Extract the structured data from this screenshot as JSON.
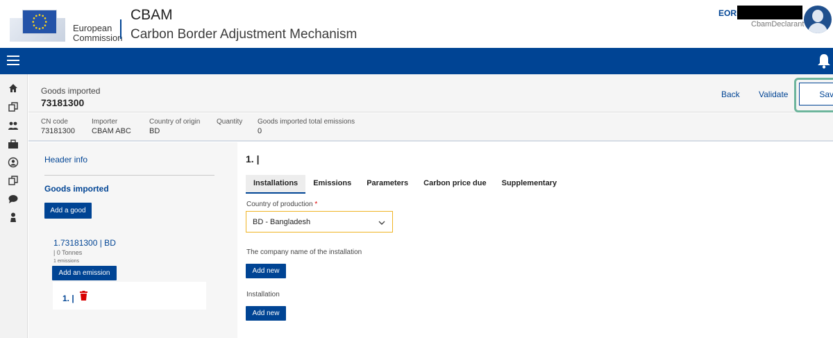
{
  "header": {
    "ec_line1": "European",
    "ec_line2": "Commission",
    "app_title": "CBAM",
    "app_subtitle": "Carbon Border Adjustment Mechanism",
    "eori_label": "EORI",
    "user_role": "CbamDeclarant"
  },
  "page": {
    "label": "Goods imported",
    "code": "73181300",
    "actions": {
      "back": "Back",
      "validate": "Validate",
      "save": "Save"
    }
  },
  "meta": [
    {
      "label": "CN code",
      "value": "73181300"
    },
    {
      "label": "Importer",
      "value": "CBAM ABC"
    },
    {
      "label": "Country of origin",
      "value": "BD"
    },
    {
      "label": "Quantity",
      "value": ""
    },
    {
      "label": "Goods imported total emissions",
      "value": "0"
    }
  ],
  "sidebar": {
    "header_info": "Header info",
    "goods_title": "Goods imported",
    "add_good": "Add a good",
    "good_item": "1.73181300 | BD",
    "good_qty": "| 0 Tonnes",
    "good_emissions": "1 emissions",
    "add_emission": "Add an emission",
    "emission_label": "1. |"
  },
  "main": {
    "title": "1. |",
    "tabs": [
      "Installations",
      "Emissions",
      "Parameters",
      "Carbon price due",
      "Supplementary"
    ],
    "country_label": "Country of production",
    "required_mark": "*",
    "country_value": "BD - Bangladesh",
    "company_label": "The company name of the installation",
    "add_new_1": "Add new",
    "installation_label": "Installation",
    "add_new_2": "Add new"
  },
  "colors": {
    "primary": "#004494",
    "highlight": "#6db59c",
    "select_border": "#f0b323",
    "danger": "#d80000"
  }
}
